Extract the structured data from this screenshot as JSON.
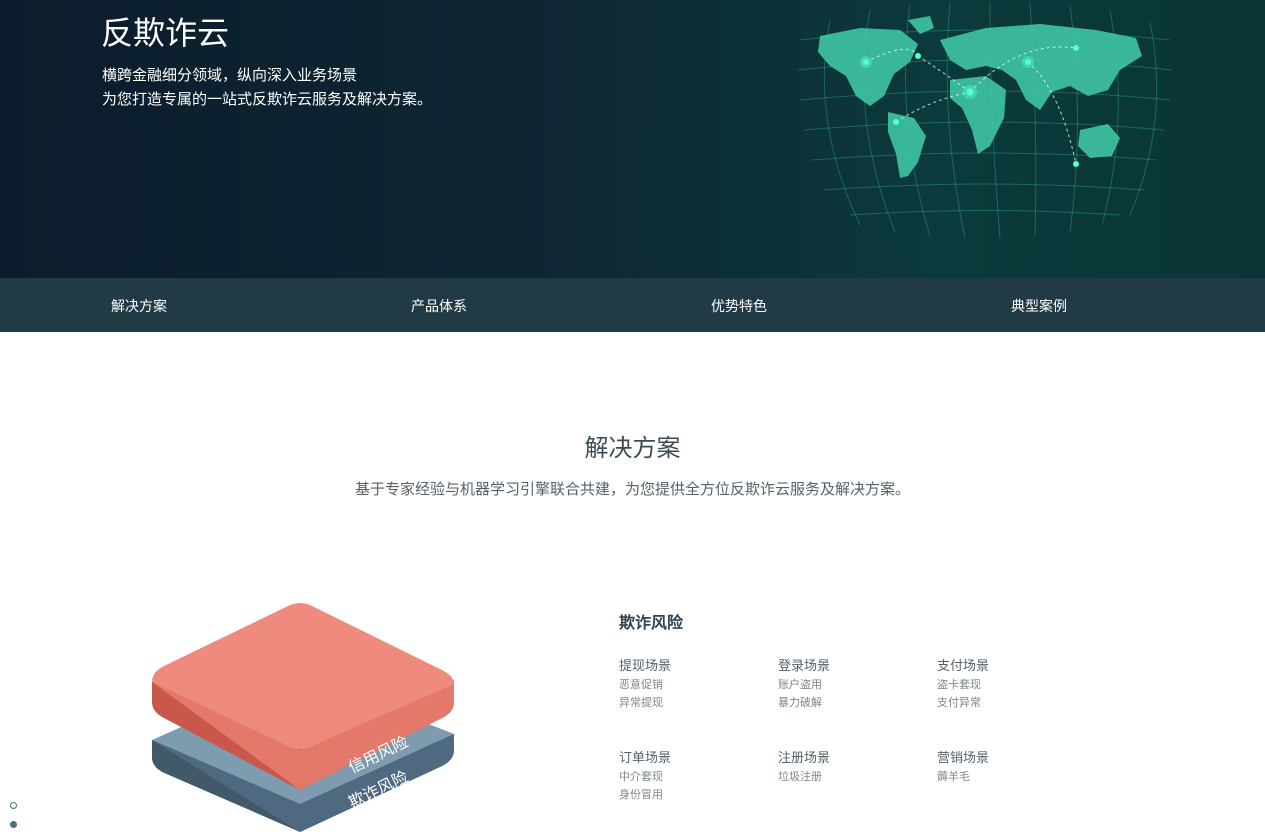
{
  "hero": {
    "title": "反欺诈云",
    "subtitle_line1": "横跨金融细分领域，纵向深入业务场景",
    "subtitle_line2": "为您打造专属的一站式反欺诈云服务及解决方案。"
  },
  "tabs": [
    {
      "label": "解决方案"
    },
    {
      "label": "产品体系"
    },
    {
      "label": "优势特色"
    },
    {
      "label": "典型案例"
    }
  ],
  "section": {
    "title": "解决方案",
    "subtitle": "基于专家经验与机器学习引擎联合共建，为您提供全方位反欺诈云服务及解决方案。"
  },
  "illustration": {
    "top_layer_label": "信用风险",
    "bottom_layer_label": "欺诈风险"
  },
  "risk": {
    "title": "欺诈风险",
    "scenes": [
      {
        "name": "提现场景",
        "items": [
          "恶意促销",
          "异常提现"
        ]
      },
      {
        "name": "登录场景",
        "items": [
          "账户盗用",
          "暴力破解"
        ]
      },
      {
        "name": "支付场景",
        "items": [
          "盗卡套现",
          "支付异常"
        ]
      },
      {
        "name": "订单场景",
        "items": [
          "中介套现",
          "身份冒用"
        ]
      },
      {
        "name": "注册场景",
        "items": [
          "垃圾注册"
        ]
      },
      {
        "name": "营销场景",
        "items": [
          "薅羊毛"
        ]
      }
    ]
  },
  "colors": {
    "hero_dark": "#0c1c2c",
    "hero_teal": "#0b3a3c",
    "tab_bar": "#213b46",
    "accent_green": "#3fd6b0",
    "credit_layer": "#ef8a7e",
    "fraud_layer": "#6f8fa0"
  }
}
